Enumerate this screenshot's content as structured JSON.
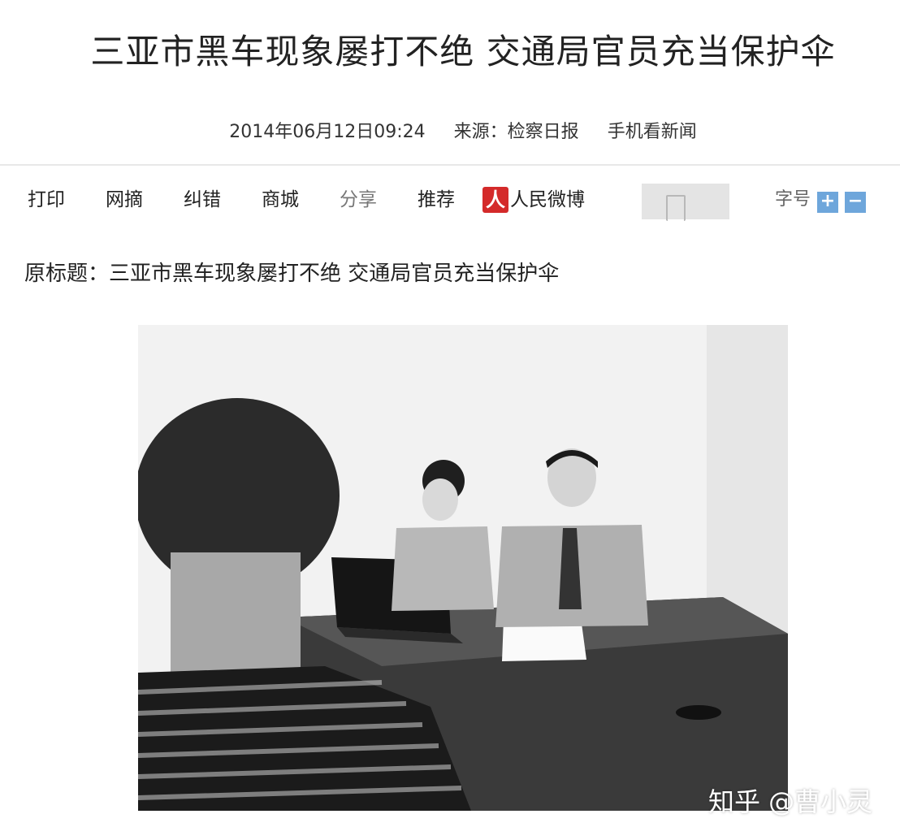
{
  "article": {
    "title": "三亚市黑车现象屡打不绝 交通局官员充当保护伞",
    "datetime": "2014年06月12日09:24",
    "source_label": "来源：检察日报",
    "mobile_link": "手机看新闻",
    "original_title": "原标题：三亚市黑车现象屡打不绝 交通局官员充当保护伞"
  },
  "toolbar": {
    "print": "打印",
    "excerpt": "网摘",
    "correct": "纠错",
    "shop": "商城",
    "share": "分享",
    "recommend": "推荐",
    "weibo_logo_char": "人",
    "weibo": "人民微博",
    "font_size_label": "字号",
    "increase": "+",
    "decrease": "−"
  },
  "watermark": "知乎 @曹小灵",
  "icons": {
    "weibo": "people-weibo-logo-icon",
    "doc": "document-placeholder-icon"
  },
  "colors": {
    "weibo_red": "#d42a2a",
    "font_button_blue": "#6ea6db"
  }
}
